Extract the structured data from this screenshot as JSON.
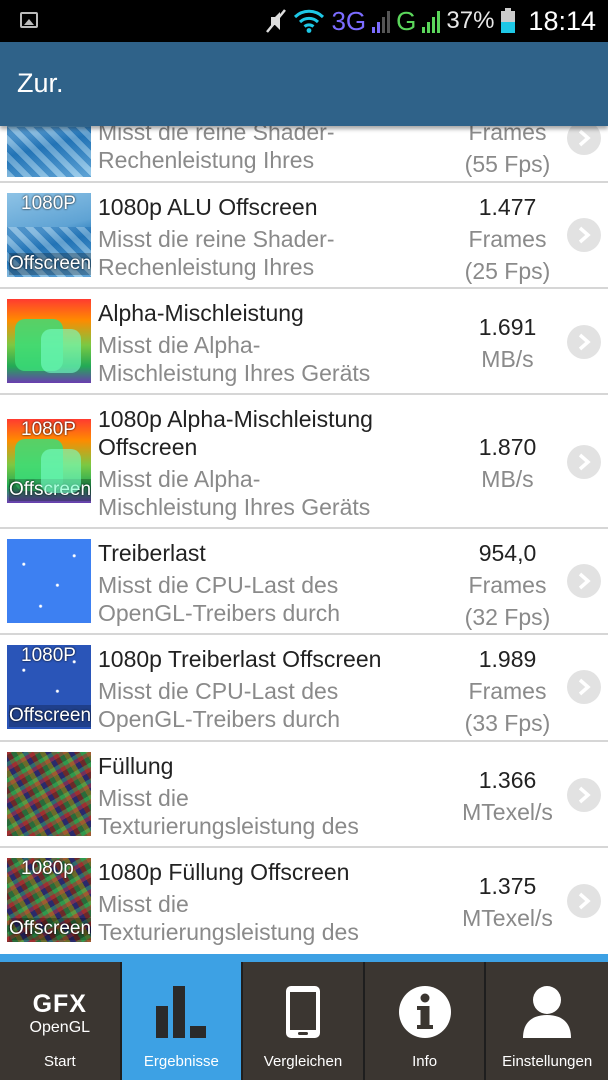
{
  "status_bar": {
    "network_3g": "3G",
    "network_g": "G",
    "battery": "37%",
    "time": "18:14"
  },
  "header": {
    "back_label": "Zur."
  },
  "results": [
    {
      "title": "",
      "desc_line1": "Misst die reine Shader-",
      "desc_line2": "Rechenleistung Ihres",
      "value": "",
      "unit": "Frames",
      "fps": "(55 Fps)",
      "thumb_icon": "shader-thumbnail"
    },
    {
      "thumb_top": "1080P",
      "thumb_bottom": "Offscreen",
      "title": "1080p ALU Offscreen",
      "desc_line1": "Misst die reine Shader-",
      "desc_line2": "Rechenleistung Ihres",
      "value": "1.477",
      "unit": "Frames",
      "fps": "(25 Fps)"
    },
    {
      "title": "Alpha-Mischleistung",
      "desc_line1": "Misst die Alpha-",
      "desc_line2": "Mischleistung Ihres Geräts",
      "value": "1.691",
      "unit": "MB/s"
    },
    {
      "thumb_top": "1080P",
      "thumb_bottom": "Offscreen",
      "title_line1": "1080p Alpha-Mischleistung",
      "title_line2": "Offscreen",
      "desc_line1": "Misst die Alpha-",
      "desc_line2": "Mischleistung Ihres Geräts",
      "value": "1.870",
      "unit": "MB/s"
    },
    {
      "title": "Treiberlast",
      "desc_line1": "Misst die CPU-Last des",
      "desc_line2": "OpenGL-Treibers durch",
      "value": "954,0",
      "unit": "Frames",
      "fps": "(32 Fps)"
    },
    {
      "thumb_top": "1080P",
      "thumb_bottom": "Offscreen",
      "title": "1080p Treiberlast Offscreen",
      "desc_line1": "Misst die CPU-Last des",
      "desc_line2": "OpenGL-Treibers durch",
      "value": "1.989",
      "unit": "Frames",
      "fps": "(33 Fps)"
    },
    {
      "title": "Füllung",
      "desc_line1": "Misst die",
      "desc_line2": "Texturierungsleistung des",
      "value": "1.366",
      "unit": "MTexel/s"
    },
    {
      "thumb_top": "1080p",
      "thumb_bottom": "Offscreen",
      "title": "1080p Füllung Offscreen",
      "desc_line1": "Misst die",
      "desc_line2": "Texturierungsleistung des",
      "value": "1.375",
      "unit": "MTexel/s"
    }
  ],
  "bottom_nav": {
    "logo_line1": "GFX",
    "logo_line2": "OpenGL",
    "tabs": [
      "Start",
      "Ergebnisse",
      "Vergleichen",
      "Info",
      "Einstellungen"
    ],
    "active_index": 1
  },
  "colors": {
    "header": "#2f6289",
    "accent": "#3da1e4",
    "nav_bg": "#3b3631"
  }
}
